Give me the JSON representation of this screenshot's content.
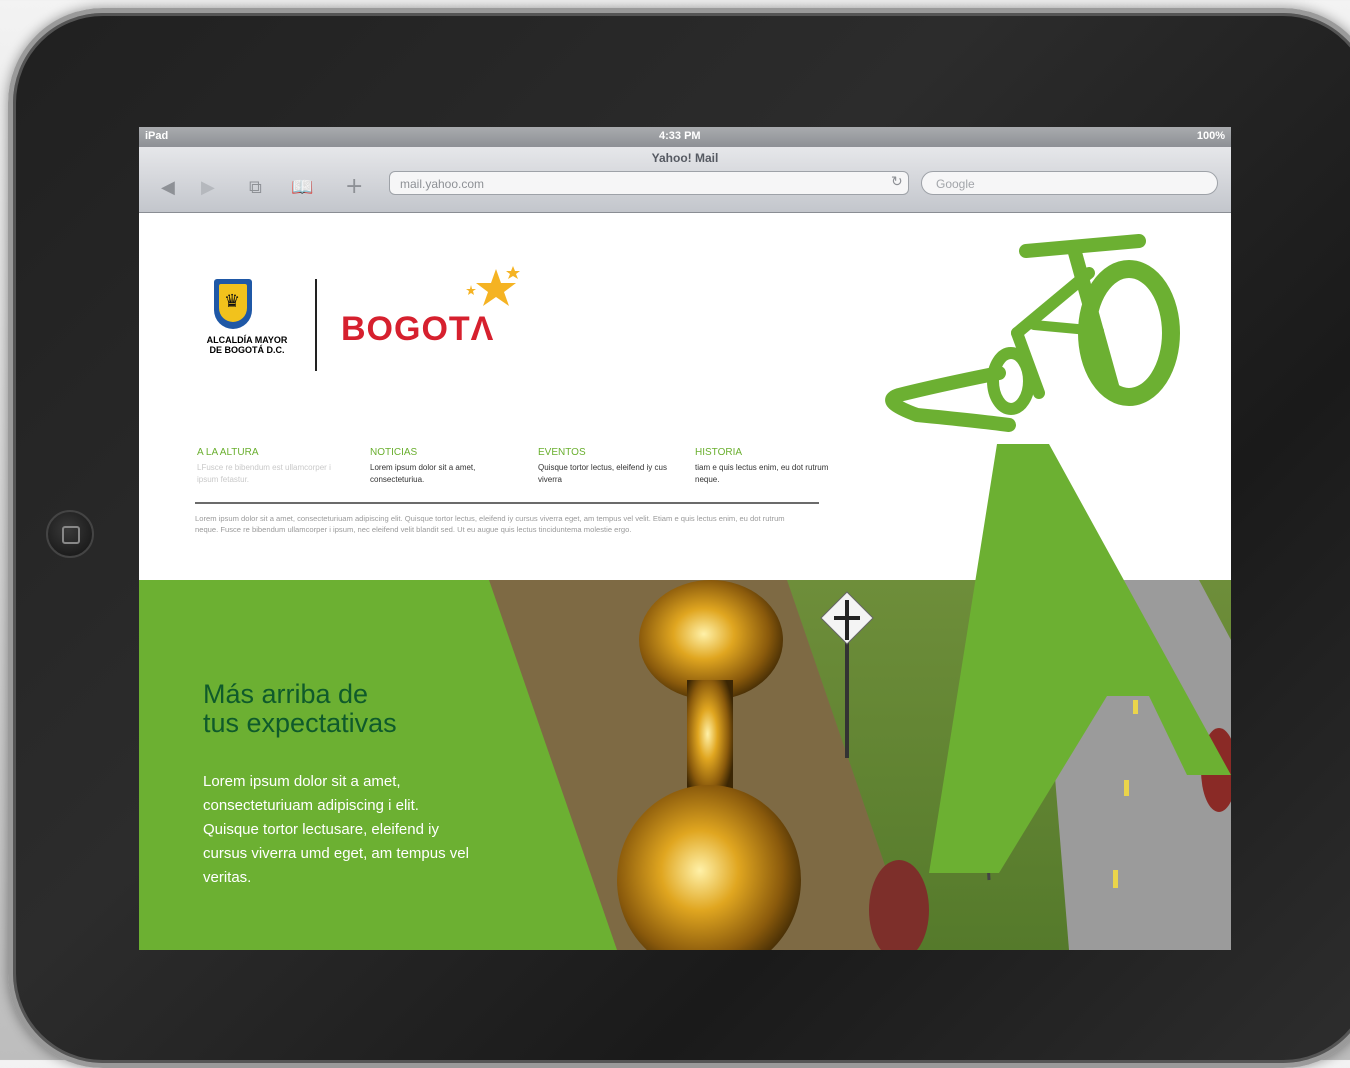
{
  "device": {
    "status": {
      "carrier": "iPad",
      "time": "4:33 PM",
      "battery": "100%"
    }
  },
  "browser": {
    "page_title": "Yahoo! Mail",
    "url": "mail.yahoo.com",
    "search_placeholder": "Google"
  },
  "site": {
    "logo": {
      "alcaldia_line1": "ALCALDÍA MAYOR",
      "alcaldia_line2": "DE BOGOTÁ D.C.",
      "brand": "BOGOTΛ"
    },
    "nav": [
      {
        "title": "A LA ALTURA",
        "desc": "LFusce re bibendum est ullamcorper i ipsum fetastur."
      },
      {
        "title": "NOTICIAS",
        "desc": "Lorem ipsum dolor sit a amet, consecteturiua."
      },
      {
        "title": "EVENTOS",
        "desc": "Quisque tortor lectus, eleifend iy cus viverra"
      },
      {
        "title": "HISTORIA",
        "desc": "tiam e quis lectus enim, eu dot rutrum neque."
      }
    ],
    "body_text": "Lorem ipsum dolor sit a amet, consecteturiuam adipiscing elit. Quisque tortor lectus, eleifend iy cursus viverra eget, am tempus vel velit. Etiam e quis lectus enim, eu dot rutrum neque. Fusce re bibendum ullamcorper i ipsum, nec eleifend velit blandit sed. Ut eu augue quis lectus tinciduntema molestie ergo.",
    "hero": {
      "title_line1": "Más arriba de",
      "title_line2": "tus expectativas",
      "text": "Lorem ipsum dolor sit a amet, consecteturiuam adipiscing i elit. Quisque tortor lectusare, eleifend iy cursus viverra umd eget, am tempus vel veritas."
    }
  },
  "colors": {
    "brand_green": "#6cb032",
    "brand_red": "#d6202e",
    "dark_green": "#0f5a2b"
  }
}
